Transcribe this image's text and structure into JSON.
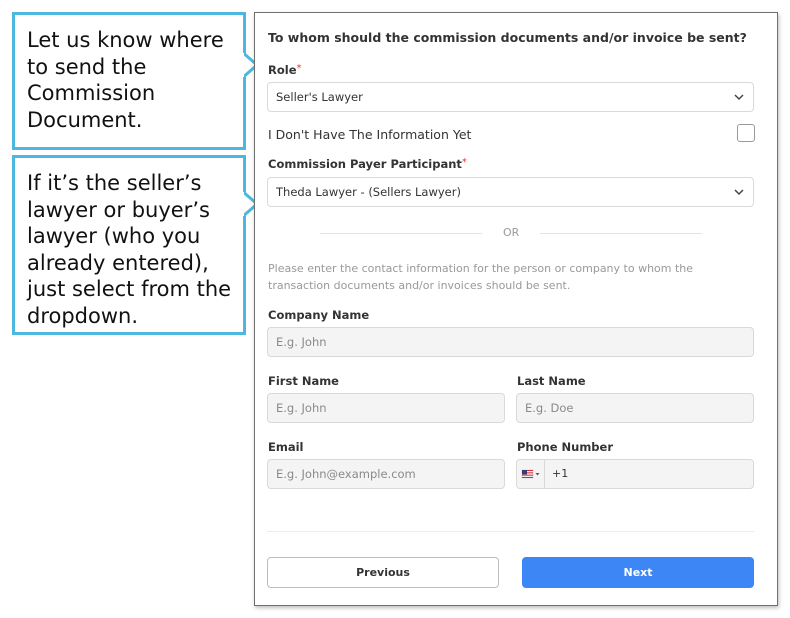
{
  "callouts": [
    {
      "text": "Let us know where\nto send the\nCommission\nDocument."
    },
    {
      "text": "If it’s the seller’s\nlawyer or buyer’s\nlawyer (who you\nalready entered),\njust select from the\ndropdown."
    }
  ],
  "form": {
    "question": "To whom should the commission documents and/or invoice be sent?",
    "role": {
      "label": "Role",
      "required_mark": "*",
      "value": "Seller's Lawyer"
    },
    "no_info": {
      "label": "I Don't Have The Information Yet",
      "checked": false
    },
    "payer": {
      "label": "Commission Payer Participant",
      "required_mark": "*",
      "value": "Theda Lawyer - (Sellers Lawyer)"
    },
    "or_text": "OR",
    "hint": "Please enter the contact information for the person or company to whom the transaction documents and/or invoices should be sent.",
    "company": {
      "label": "Company Name",
      "placeholder": "E.g. John"
    },
    "first_name": {
      "label": "First Name",
      "placeholder": "E.g. John"
    },
    "last_name": {
      "label": "Last Name",
      "placeholder": "E.g. Doe"
    },
    "email": {
      "label": "Email",
      "placeholder": "E.g. John@example.com"
    },
    "phone": {
      "label": "Phone Number",
      "code": "+1",
      "flag_icon": "us-flag-icon"
    },
    "buttons": {
      "previous": "Previous",
      "next": "Next"
    }
  },
  "colors": {
    "accent": "#3d86f5",
    "callout_border": "#4cb8e0",
    "required": "#e0393e"
  }
}
